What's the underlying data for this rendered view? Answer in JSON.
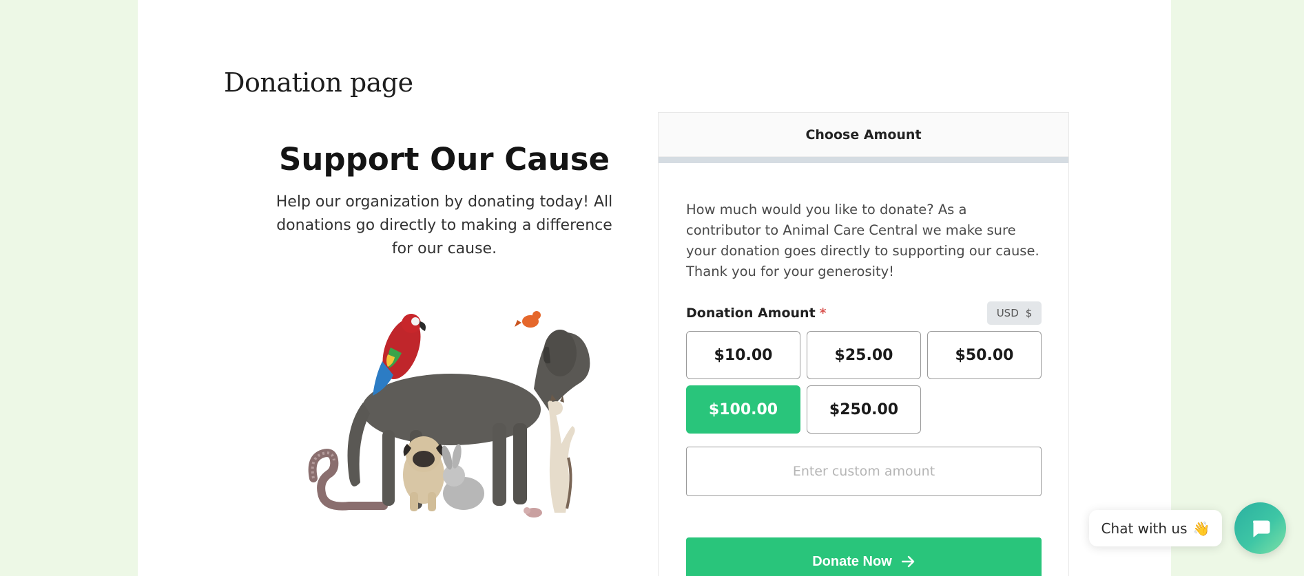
{
  "page": {
    "title": "Donation page"
  },
  "cause": {
    "heading": "Support Our Cause",
    "text": "Help our organization by donating today! All donations go directly to making a difference for our cause."
  },
  "donation_card": {
    "header": "Choose Amount",
    "description": "How much would you like to donate? As a contributor to Animal Care Central we make sure your donation goes directly to supporting our cause. Thank you for your generosity!",
    "amount_label": "Donation Amount",
    "required_marker": "*",
    "currency": {
      "code": "USD",
      "symbol": "$"
    },
    "amounts": [
      {
        "label": "$10.00",
        "selected": false
      },
      {
        "label": "$25.00",
        "selected": false
      },
      {
        "label": "$50.00",
        "selected": false
      },
      {
        "label": "$100.00",
        "selected": true
      },
      {
        "label": "$250.00",
        "selected": false
      }
    ],
    "custom_amount_placeholder": "Enter custom amount",
    "donate_label": "Donate Now"
  },
  "chat": {
    "label": "Chat with us",
    "wave": "👋"
  },
  "colors": {
    "background": "#edf8e6",
    "accent": "#29c57b",
    "progress_track": "#d5dce2"
  }
}
